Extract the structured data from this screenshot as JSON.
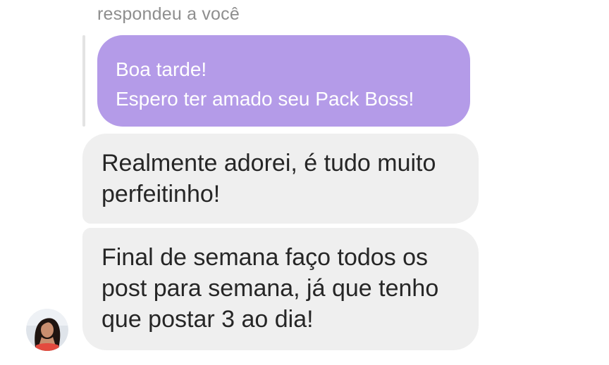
{
  "reply_header": "respondeu a você",
  "quoted_message": {
    "lines": [
      "Boa tarde!",
      "Espero ter amado seu Pack Boss!"
    ]
  },
  "messages": [
    {
      "lines": [
        "Realmente adorei, é tudo muito",
        "perfeitinho!"
      ]
    },
    {
      "lines": [
        "Final de semana faço todos os",
        "post para semana, já que tenho",
        "que postar 3 ao dia!"
      ]
    }
  ],
  "colors": {
    "quoted_bubble": "#b49be8",
    "received_bubble": "#efefef",
    "header_text": "#8e8e8e"
  },
  "icons": {
    "avatar": "contact-avatar"
  }
}
